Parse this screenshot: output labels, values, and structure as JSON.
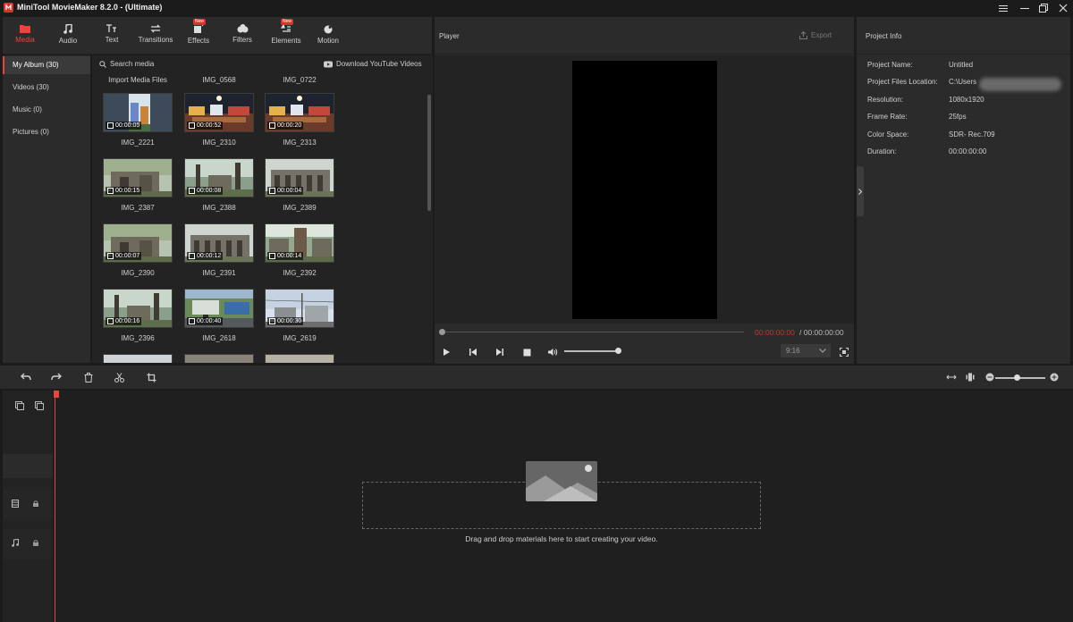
{
  "window": {
    "title": "MiniTool MovieMaker 8.2.0 - (Ultimate)",
    "controls": [
      "menu-icon",
      "minimize-icon",
      "maximize-icon",
      "close-icon"
    ]
  },
  "toolbar": {
    "tabs": [
      {
        "label": "Media",
        "icon": "folder-icon",
        "active": true,
        "new": false
      },
      {
        "label": "Audio",
        "icon": "music-note-icon",
        "active": false,
        "new": false
      },
      {
        "label": "Text",
        "icon": "text-icon",
        "active": false,
        "new": false
      },
      {
        "label": "Transitions",
        "icon": "transitions-icon",
        "active": false,
        "new": false
      },
      {
        "label": "Effects",
        "icon": "effects-icon",
        "active": false,
        "new": true
      },
      {
        "label": "Filters",
        "icon": "filters-icon",
        "active": false,
        "new": false
      },
      {
        "label": "Elements",
        "icon": "elements-icon",
        "active": false,
        "new": true
      },
      {
        "label": "Motion",
        "icon": "motion-icon",
        "active": false,
        "new": false
      }
    ],
    "new_badge": "New"
  },
  "sidebar": {
    "items": [
      {
        "label": "My Album (30)",
        "active": true
      },
      {
        "label": "Videos (30)",
        "active": false
      },
      {
        "label": "Music (0)",
        "active": false
      },
      {
        "label": "Pictures (0)",
        "active": false
      }
    ]
  },
  "media": {
    "search_label": "Search media",
    "youtube_label": "Download YouTube Videos",
    "top_labels": [
      "Import Media Files",
      "IMG_0568",
      "IMG_0722"
    ],
    "items": [
      {
        "name": "IMG_2221",
        "duration": "00:00:05",
        "scene": "portrait-city"
      },
      {
        "name": "IMG_2310",
        "duration": "00:00:52",
        "scene": "night-market"
      },
      {
        "name": "IMG_2313",
        "duration": "00:00:20",
        "scene": "night-market"
      },
      {
        "name": "IMG_2387",
        "duration": "00:00:15",
        "scene": "ruins"
      },
      {
        "name": "IMG_2388",
        "duration": "00:00:08",
        "scene": "forest"
      },
      {
        "name": "IMG_2389",
        "duration": "00:00:04",
        "scene": "temple"
      },
      {
        "name": "IMG_2390",
        "duration": "00:00:07",
        "scene": "ruins"
      },
      {
        "name": "IMG_2391",
        "duration": "00:00:12",
        "scene": "temple"
      },
      {
        "name": "IMG_2392",
        "duration": "00:00:14",
        "scene": "tree"
      },
      {
        "name": "IMG_2396",
        "duration": "00:00:16",
        "scene": "forest"
      },
      {
        "name": "IMG_2618",
        "duration": "00:00:40",
        "scene": "street"
      },
      {
        "name": "IMG_2619",
        "duration": "00:00:30",
        "scene": "sky-street"
      }
    ]
  },
  "player": {
    "title": "Player",
    "export_label": "Export",
    "current_time": "00:00:00:00",
    "separator": " / ",
    "total_time": "00:00:00:00",
    "aspect_ratio": "9:16",
    "volume": 1.0,
    "progress": 0.0
  },
  "project_info": {
    "title": "Project Info",
    "rows": [
      {
        "key": "Project Name:",
        "value": "Untitled"
      },
      {
        "key": "Project Files Location:",
        "value": "C:\\Users"
      },
      {
        "key": "Resolution:",
        "value": "1080x1920"
      },
      {
        "key": "Frame Rate:",
        "value": "25fps"
      },
      {
        "key": "Color Space:",
        "value": "SDR- Rec.709"
      },
      {
        "key": "Duration:",
        "value": "00:00:00:00"
      }
    ]
  },
  "timeline": {
    "drop_text": "Drag and drop materials here to start creating your video.",
    "zoom": 0.4
  },
  "colors": {
    "accent": "#e8453c",
    "panel": "#2b2b2b",
    "background": "#1b1b1b"
  }
}
